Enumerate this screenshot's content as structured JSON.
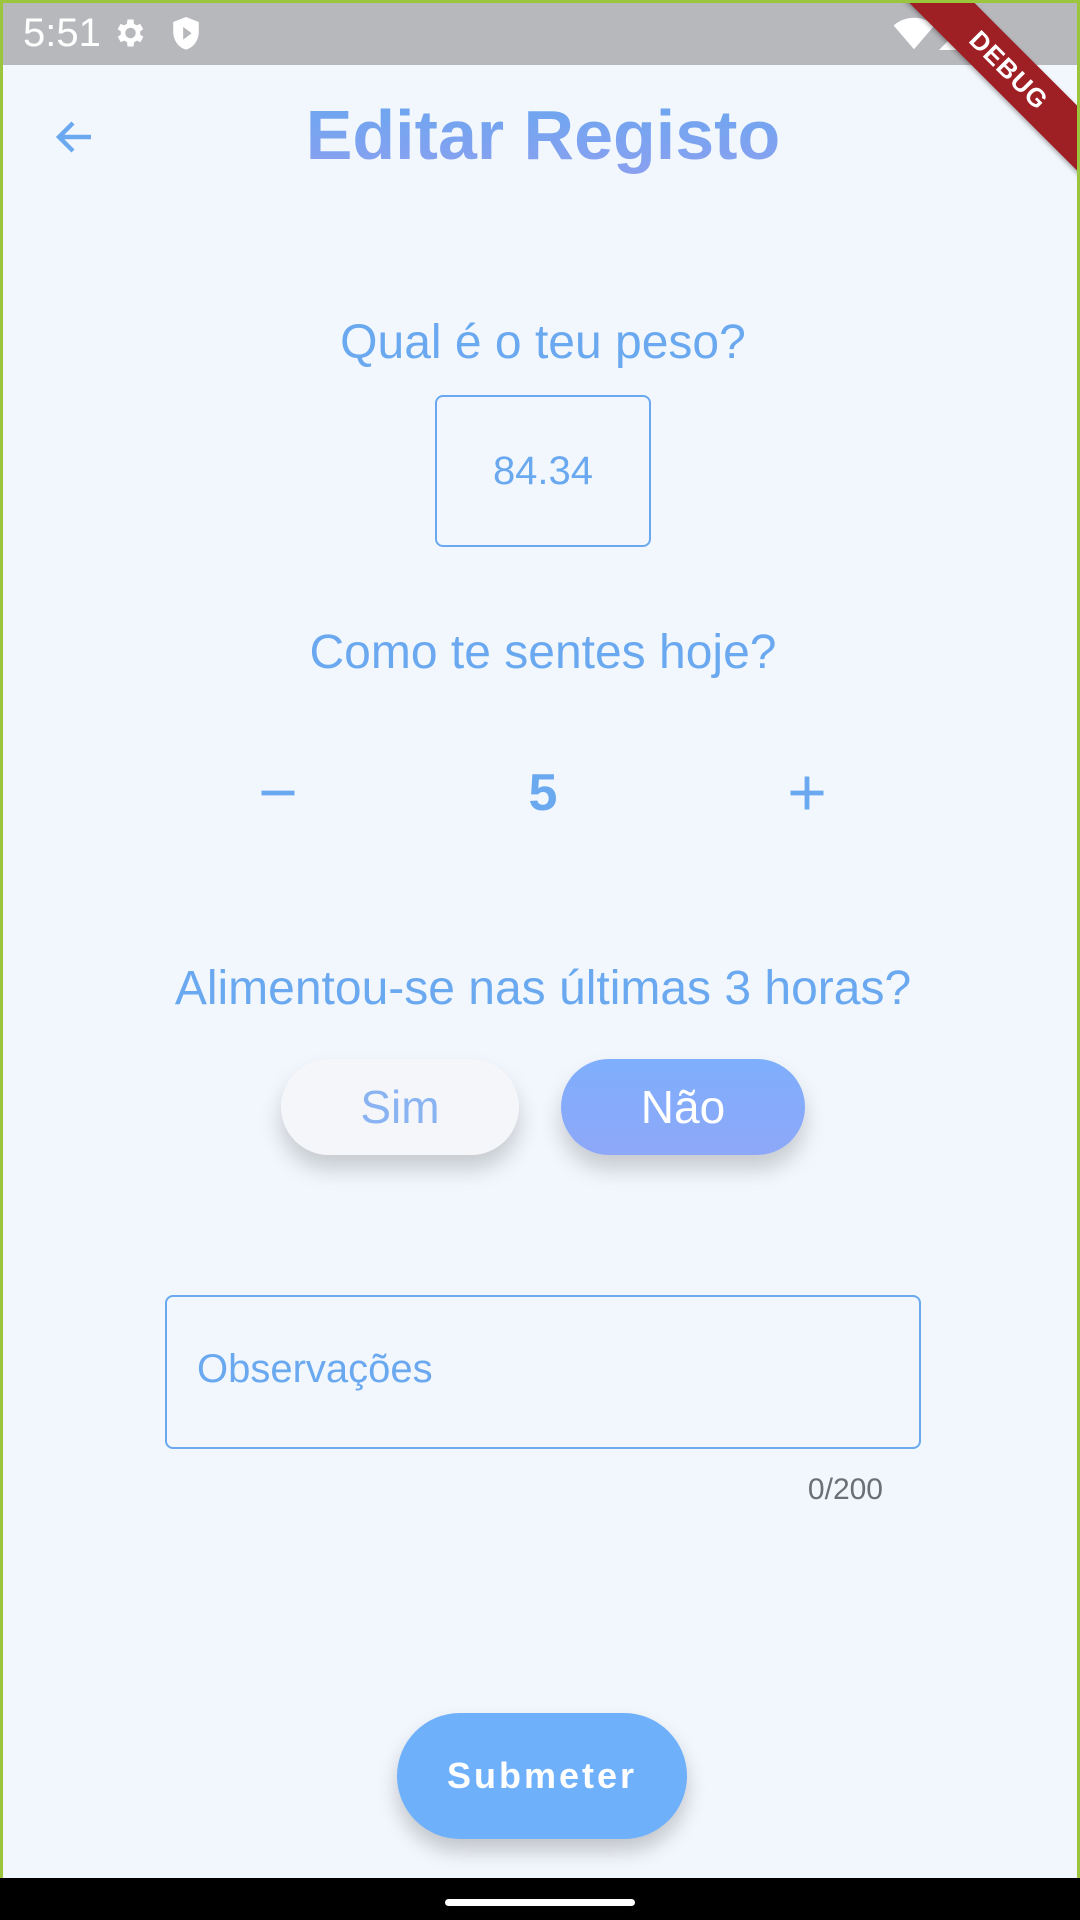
{
  "status_bar": {
    "time": "5:51",
    "icons": [
      "gear-icon",
      "shield-icon",
      "wifi-icon",
      "signal-icon"
    ]
  },
  "debug_banner": "DEBUG",
  "app_bar": {
    "back_icon": "arrow-left-icon",
    "title": "Editar Registo"
  },
  "weight": {
    "question": "Qual é o teu peso?",
    "value": "84.34"
  },
  "feeling": {
    "question": "Como te sentes hoje?",
    "decrement_label": "−",
    "value": "5",
    "increment_label": "+"
  },
  "fed": {
    "question": "Alimentou-se nas últimas 3 horas?",
    "options": [
      "Sim",
      "Não"
    ],
    "selected": "Não"
  },
  "notes": {
    "placeholder": "Observações",
    "counter": "0/200"
  },
  "submit_label": "Submeter",
  "colors": {
    "accent": "#6aa9f0",
    "background": "#f2f7fd",
    "submit": "#6fb0fb",
    "selected_toggle": "#8ea8f8",
    "debug": "#9e1f24"
  }
}
